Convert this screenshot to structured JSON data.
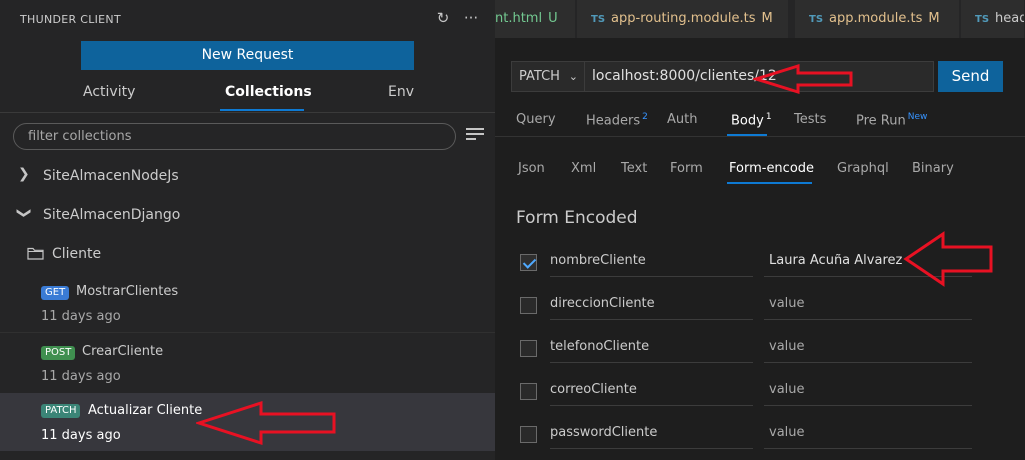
{
  "sidebar": {
    "title": "THUNDER CLIENT",
    "new_request_label": "New Request",
    "tabs": [
      {
        "label": "Activity"
      },
      {
        "label": "Collections"
      },
      {
        "label": "Env"
      }
    ],
    "filter_placeholder": "filter collections",
    "collections": [
      {
        "name": "SiteAlmacenNodeJs",
        "expanded": false
      },
      {
        "name": "SiteAlmacenDjango",
        "expanded": true
      }
    ],
    "folder": {
      "name": "Cliente"
    },
    "requests": [
      {
        "method": "GET",
        "name": "MostrarClientes",
        "time": "11 days ago"
      },
      {
        "method": "POST",
        "name": "CrearCliente",
        "time": "11 days ago"
      },
      {
        "method": "PATCH",
        "name": "Actualizar Cliente",
        "time": "11 days ago"
      }
    ]
  },
  "editor_tabs": [
    {
      "icon": "",
      "name": "nt.html",
      "status": "U"
    },
    {
      "icon": "TS",
      "name": "app-routing.module.ts",
      "status": "M"
    },
    {
      "icon": "TS",
      "name": "app.module.ts",
      "status": "M"
    },
    {
      "icon": "TS",
      "name": "head",
      "status": ""
    }
  ],
  "request": {
    "method": "PATCH",
    "url": "localhost:8000/clientes/12",
    "send_label": "Send",
    "tabs": [
      {
        "label": "Query",
        "badge": ""
      },
      {
        "label": "Headers",
        "badge": "2"
      },
      {
        "label": "Auth",
        "badge": ""
      },
      {
        "label": "Body",
        "badge": "1"
      },
      {
        "label": "Tests",
        "badge": ""
      },
      {
        "label": "Pre Run",
        "badge": "New"
      }
    ],
    "body_tabs": [
      "Json",
      "Xml",
      "Text",
      "Form",
      "Form-encode",
      "Graphql",
      "Binary"
    ],
    "form_title": "Form Encoded",
    "form_rows": [
      {
        "key": "nombreCliente",
        "value": "Laura Acuña Alvarez",
        "checked": true
      },
      {
        "key": "direccionCliente",
        "value": "value",
        "checked": false
      },
      {
        "key": "telefonoCliente",
        "value": "value",
        "checked": false
      },
      {
        "key": "correoCliente",
        "value": "value",
        "checked": false
      },
      {
        "key": "passwordCliente",
        "value": "value",
        "checked": false
      }
    ]
  },
  "colors": {
    "accent": "#0e639c",
    "annotation_arrow": "#e81123"
  }
}
